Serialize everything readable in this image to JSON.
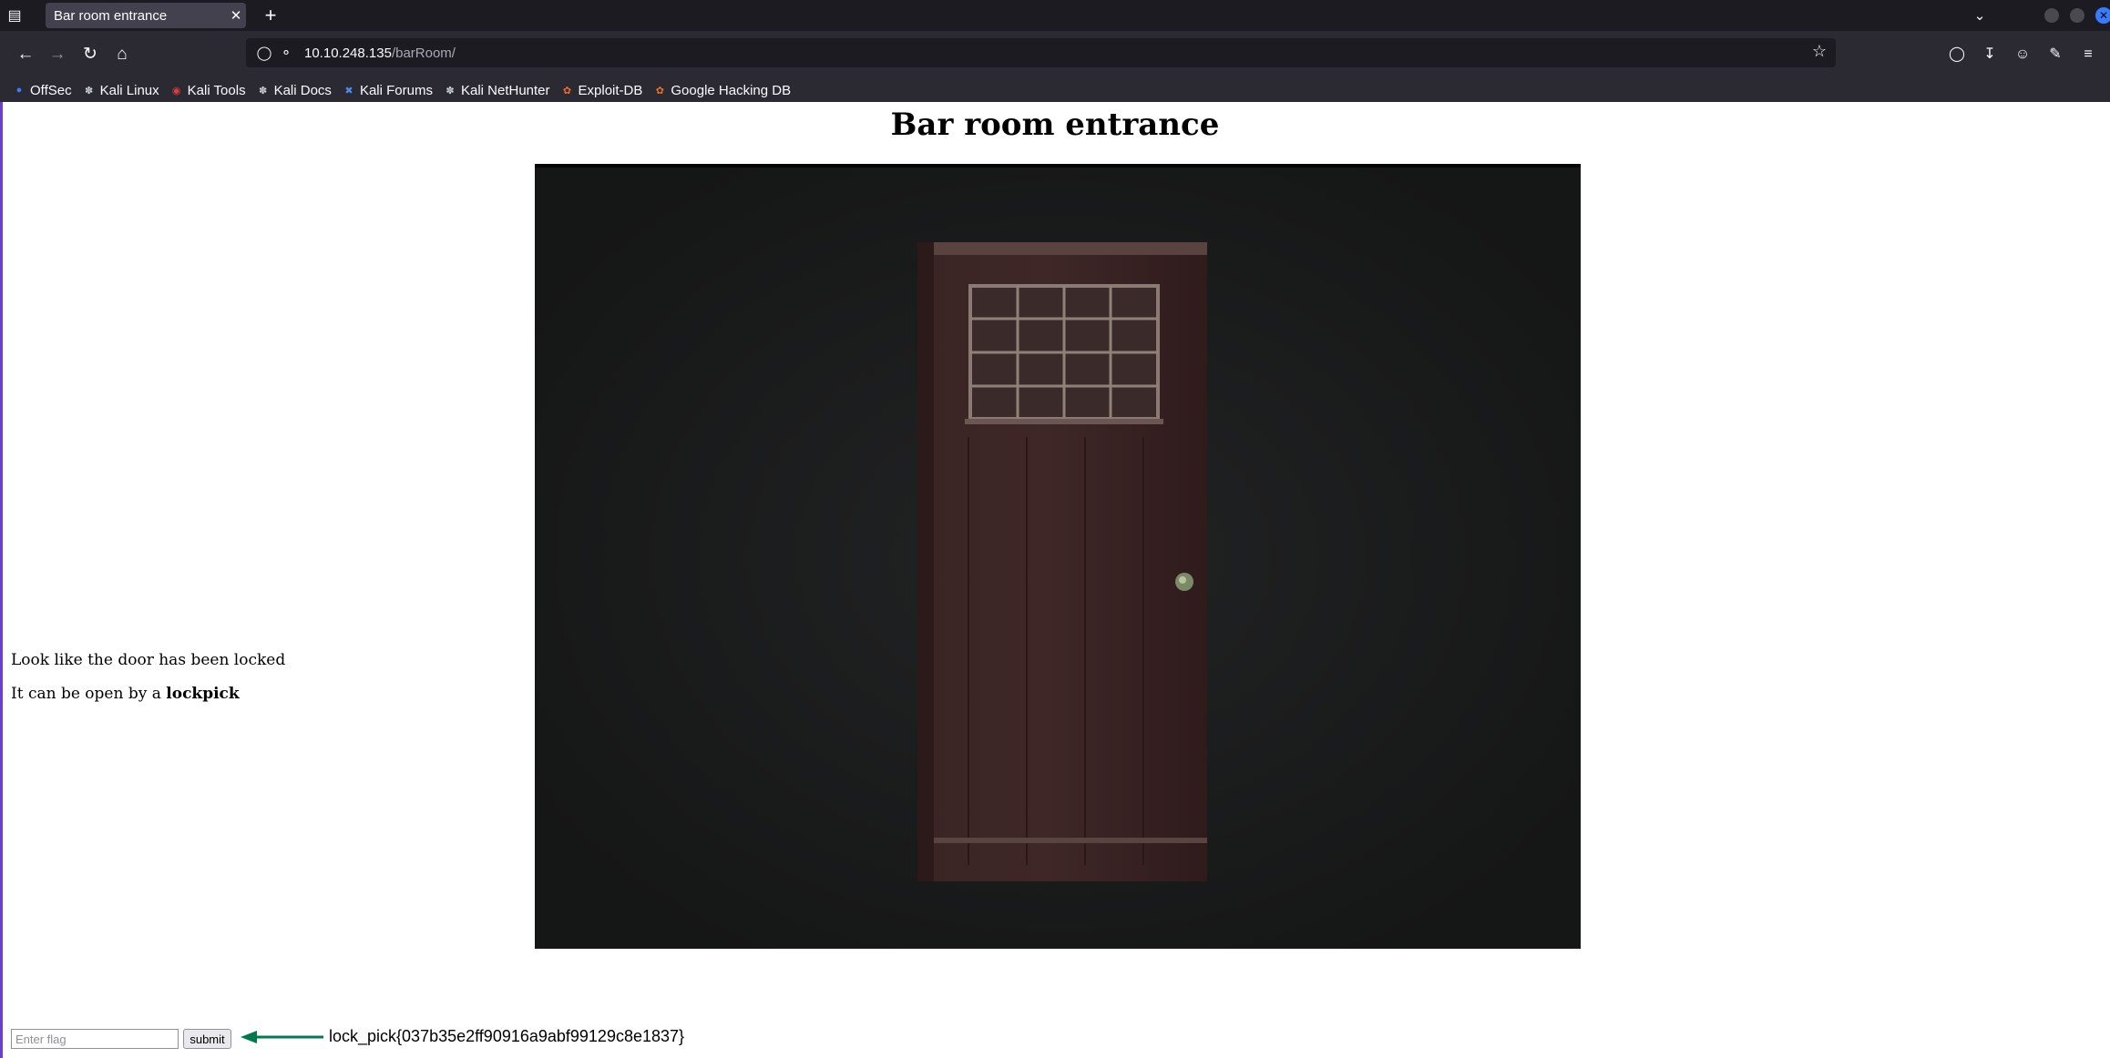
{
  "browser": {
    "tab_title": "Bar room entrance",
    "url_host": "10.10.248.135",
    "url_path": "/barRoom/",
    "bookmarks": [
      {
        "label": "OffSec"
      },
      {
        "label": "Kali Linux"
      },
      {
        "label": "Kali Tools"
      },
      {
        "label": "Kali Docs"
      },
      {
        "label": "Kali Forums"
      },
      {
        "label": "Kali NetHunter"
      },
      {
        "label": "Exploit-DB"
      },
      {
        "label": "Google Hacking DB"
      }
    ]
  },
  "page": {
    "heading": "Bar room entrance",
    "line1": "Look like the door has been locked",
    "line2_prefix": "It can be open by a ",
    "line2_bold": "lockpick",
    "flag_placeholder": "Enter flag",
    "submit_label": "submit"
  },
  "annotation": {
    "flag_text": "lock_pick{037b35e2ff90916a9abf99129c8e1837}",
    "arrow_color": "#007a4d"
  }
}
